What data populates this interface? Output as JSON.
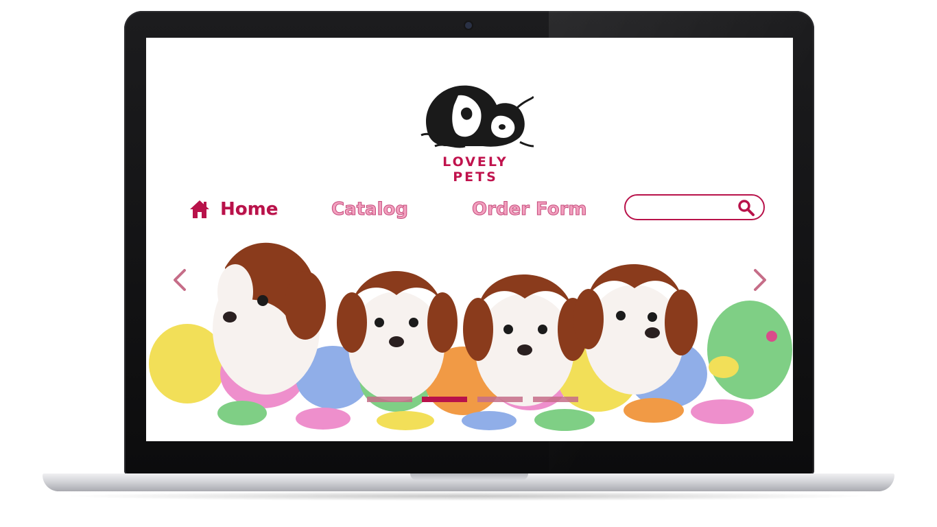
{
  "brand": {
    "name": "LOVELY PETS",
    "color": "#c0134d"
  },
  "nav": {
    "items": [
      {
        "label": "Home",
        "icon": "home-icon",
        "active": true
      },
      {
        "label": "Catalog",
        "active": false
      },
      {
        "label": "Order Form",
        "active": false
      }
    ]
  },
  "search": {
    "value": "",
    "placeholder": "",
    "icon": "magnifier-icon"
  },
  "slider": {
    "prev_icon": "chevron-left-icon",
    "next_icon": "chevron-right-icon",
    "slide_count": 4,
    "active_index": 1
  },
  "colors": {
    "accent": "#b8124a",
    "nav_inactive": "#f2a0bf",
    "arrow": "#c66d88"
  }
}
